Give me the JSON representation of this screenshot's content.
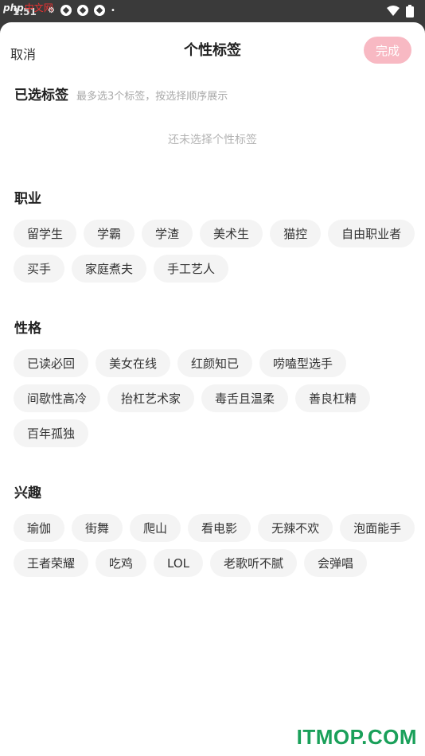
{
  "status_bar": {
    "watermark_logo": "php",
    "watermark_site": "中文网",
    "time": "1:51"
  },
  "header": {
    "cancel": "取消",
    "title": "个性标签",
    "done": "完成"
  },
  "selected": {
    "title": "已选标签",
    "hint": "最多选3个标签，按选择顺序展示",
    "empty": "还未选择个性标签"
  },
  "sections": [
    {
      "title": "职业",
      "tags": [
        "留学生",
        "学霸",
        "学渣",
        "美术生",
        "猫控",
        "自由职业者",
        "买手",
        "家庭煮夫",
        "手工艺人"
      ]
    },
    {
      "title": "性格",
      "tags": [
        "已读必回",
        "美女在线",
        "红颜知已",
        "唠嗑型选手",
        "间歇性高冷",
        "抬杠艺术家",
        "毒舌且温柔",
        "善良杠精",
        "百年孤独"
      ]
    },
    {
      "title": "兴趣",
      "tags": [
        "瑜伽",
        "街舞",
        "爬山",
        "看电影",
        "无辣不欢",
        "泡面能手",
        "王者荣耀",
        "吃鸡",
        "LOL",
        "老歌听不腻",
        "会弹唱"
      ]
    }
  ],
  "watermark": "ITMOP.COM",
  "colors": {
    "done_button": "#f8b9c3",
    "tag_bg": "#f4f4f4",
    "watermark": "#1aa05a"
  }
}
